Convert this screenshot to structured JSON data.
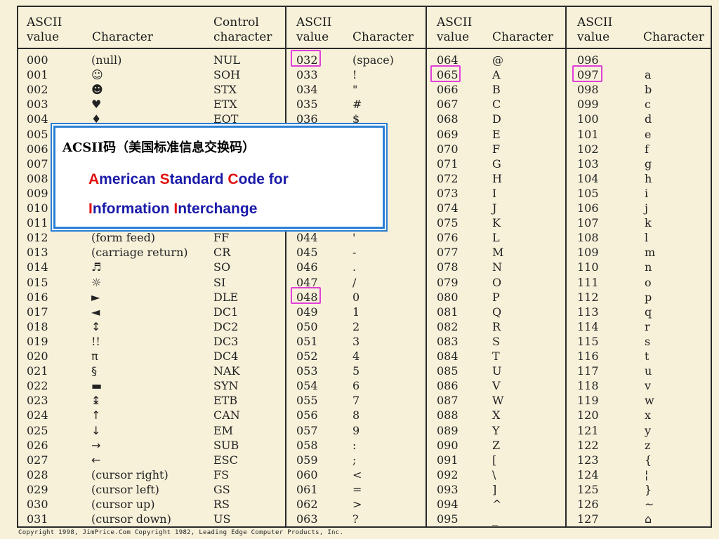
{
  "headers": {
    "ascii_value": "ASCII\nvalue",
    "character": "Character",
    "control_character": "Control\ncharacter"
  },
  "colors": {
    "highlight": "#e040d8",
    "overlay_border": "#2a7fd4",
    "overlay_text": "#1a1aa8",
    "overlay_accent": "#e01010"
  },
  "columns": [
    {
      "values": [
        "000",
        "001",
        "002",
        "003",
        "004",
        "005",
        "006",
        "007",
        "008",
        "009",
        "010",
        "011",
        "012",
        "013",
        "014",
        "015",
        "016",
        "017",
        "018",
        "019",
        "020",
        "021",
        "022",
        "023",
        "024",
        "025",
        "026",
        "027",
        "028",
        "029",
        "030",
        "031"
      ],
      "chars": [
        "(null)",
        "☺",
        "☻",
        "♥",
        "♦",
        "",
        "",
        "",
        "",
        "",
        "",
        "",
        "(form feed)",
        "(carriage return)",
        "♬",
        "☼",
        "►",
        "◄",
        "↕",
        "!!",
        "π",
        "§",
        "▬",
        "↨",
        "↑",
        "↓",
        "→",
        "←",
        "(cursor right)",
        "(cursor left)",
        "(cursor up)",
        "(cursor down)"
      ],
      "controls": [
        "NUL",
        "SOH",
        "STX",
        "ETX",
        "EOT",
        "",
        "",
        "",
        "",
        "",
        "",
        "",
        "FF",
        "CR",
        "SO",
        "SI",
        "DLE",
        "DC1",
        "DC2",
        "DC3",
        "DC4",
        "NAK",
        "SYN",
        "ETB",
        "CAN",
        "EM",
        "SUB",
        "ESC",
        "FS",
        "GS",
        "RS",
        "US"
      ]
    },
    {
      "values": [
        "032",
        "033",
        "034",
        "035",
        "036",
        "",
        "",
        "",
        "",
        "",
        "",
        "",
        "044",
        "045",
        "046",
        "047",
        "048",
        "049",
        "050",
        "051",
        "052",
        "053",
        "054",
        "055",
        "056",
        "057",
        "058",
        "059",
        "060",
        "061",
        "062",
        "063"
      ],
      "chars": [
        "(space)",
        "!",
        "\"",
        "#",
        "$",
        "",
        "",
        "",
        "",
        "",
        "",
        "",
        "'",
        "-",
        ".",
        "/",
        "0",
        "1",
        "2",
        "3",
        "4",
        "5",
        "6",
        "7",
        "8",
        "9",
        ":",
        ";",
        "<",
        "=",
        ">",
        "?"
      ]
    },
    {
      "values": [
        "064",
        "065",
        "066",
        "067",
        "068",
        "069",
        "070",
        "071",
        "072",
        "073",
        "074",
        "075",
        "076",
        "077",
        "078",
        "079",
        "080",
        "081",
        "082",
        "083",
        "084",
        "085",
        "086",
        "087",
        "088",
        "089",
        "090",
        "091",
        "092",
        "093",
        "094",
        "095"
      ],
      "chars": [
        "@",
        "A",
        "B",
        "C",
        "D",
        "E",
        "F",
        "G",
        "H",
        "I",
        "J",
        "K",
        "L",
        "M",
        "N",
        "O",
        "P",
        "Q",
        "R",
        "S",
        "T",
        "U",
        "V",
        "W",
        "X",
        "Y",
        "Z",
        "[",
        "\\",
        "]",
        "^",
        "_"
      ]
    },
    {
      "values": [
        "096",
        "097",
        "098",
        "099",
        "100",
        "101",
        "102",
        "103",
        "104",
        "105",
        "106",
        "107",
        "108",
        "109",
        "110",
        "111",
        "112",
        "113",
        "114",
        "115",
        "116",
        "117",
        "118",
        "119",
        "120",
        "121",
        "122",
        "123",
        "124",
        "125",
        "126",
        "127"
      ],
      "chars": [
        "",
        "a",
        "b",
        "c",
        "d",
        "e",
        "f",
        "g",
        "h",
        "i",
        "j",
        "k",
        "l",
        "m",
        "n",
        "o",
        "p",
        "q",
        "r",
        "s",
        "t",
        "u",
        "v",
        "w",
        "x",
        "y",
        "z",
        "{",
        "¦",
        "}",
        "~",
        "⌂"
      ]
    }
  ],
  "overlay": {
    "title": "ACSII码（美国标准信息交换码）",
    "line1_parts": [
      {
        "t": "A",
        "red": true
      },
      {
        "t": "merican ",
        "red": false
      },
      {
        "t": "S",
        "red": true
      },
      {
        "t": "tandard ",
        "red": false
      },
      {
        "t": "C",
        "red": true
      },
      {
        "t": "ode for",
        "red": false
      }
    ],
    "line2_parts": [
      {
        "t": "I",
        "red": true
      },
      {
        "t": "nformation ",
        "red": false
      },
      {
        "t": "I",
        "red": true
      },
      {
        "t": "nterchange",
        "red": false
      }
    ]
  },
  "highlighted": [
    "032",
    "065",
    "097",
    "048"
  ],
  "footer": "Copyright 1998, JimPrice.Com    Copyright 1982, Leading Edge Computer Products, Inc."
}
